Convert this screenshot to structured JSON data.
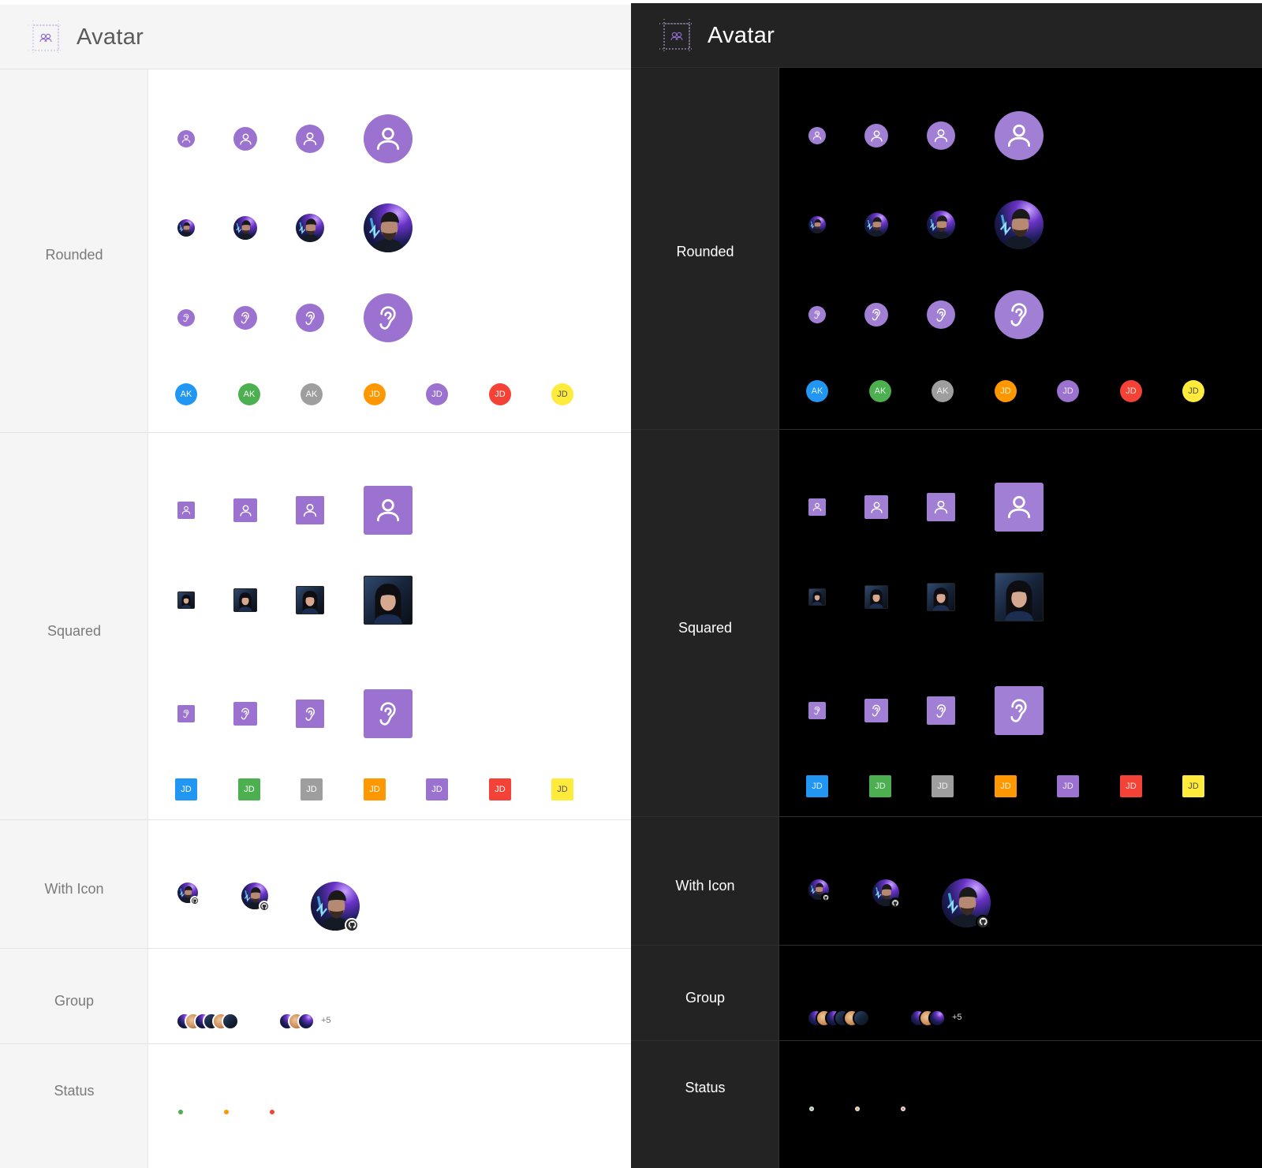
{
  "title": "Avatar",
  "rows": {
    "rounded": "Rounded",
    "squared": "Squared",
    "with_icon": "With Icon",
    "group": "Group",
    "status": "Status"
  },
  "initials_rounded": [
    "AK",
    "AK",
    "AK",
    "JD",
    "JD",
    "JD",
    "JD"
  ],
  "initials_squared": [
    "JD",
    "JD",
    "JD",
    "JD",
    "JD",
    "JD",
    "JD"
  ],
  "initial_colors": [
    "#2196f3",
    "#4caf50",
    "#9e9e9e",
    "#ff9800",
    "#9b72d0",
    "#f44336",
    "#ffeb3b"
  ],
  "group_overflow": "+5",
  "status_colors": [
    "#4caf50",
    "#ff9800",
    "#f44336"
  ],
  "accent": "#9b72d0"
}
